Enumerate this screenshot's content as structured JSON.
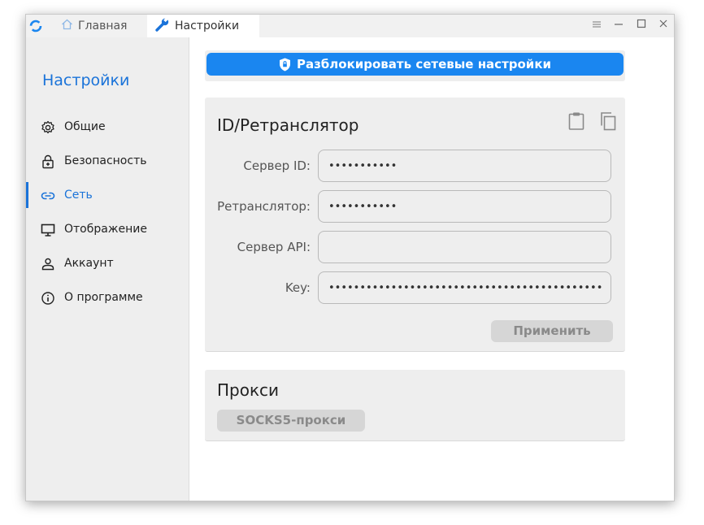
{
  "titlebar": {
    "tabs": [
      {
        "label": "Главная",
        "icon": "home-icon"
      },
      {
        "label": "Настройки",
        "icon": "wrench-icon"
      }
    ],
    "controls": [
      "menu-icon",
      "minimize-icon",
      "maximize-icon",
      "close-icon"
    ]
  },
  "sidebar": {
    "title": "Настройки",
    "items": [
      {
        "label": "Общие",
        "icon": "gear-icon"
      },
      {
        "label": "Безопасность",
        "icon": "lock-icon"
      },
      {
        "label": "Сеть",
        "icon": "link-icon",
        "active": true
      },
      {
        "label": "Отображение",
        "icon": "monitor-icon"
      },
      {
        "label": "Аккаунт",
        "icon": "user-icon"
      },
      {
        "label": "О программе",
        "icon": "info-icon"
      }
    ]
  },
  "main": {
    "unlock_button": "Разблокировать сетевые настройки",
    "id_card": {
      "title": "ID/Ретранслятор",
      "fields": [
        {
          "label": "Сервер ID:",
          "value": "•••••••••••"
        },
        {
          "label": "Ретранслятор:",
          "value": "•••••••••••"
        },
        {
          "label": "Сервер API:",
          "value": ""
        },
        {
          "label": "Key:",
          "value": "••••••••••••••••••••••••••••••••••••••••••••"
        }
      ],
      "apply_button": "Применить"
    },
    "proxy_card": {
      "title": "Прокси",
      "socks_button": "SOCKS5-прокси"
    }
  },
  "colors": {
    "accent": "#1a73d9",
    "button_primary": "#1a86f0",
    "panel": "#eeeeee",
    "disabled_button": "#d6d6d6"
  }
}
